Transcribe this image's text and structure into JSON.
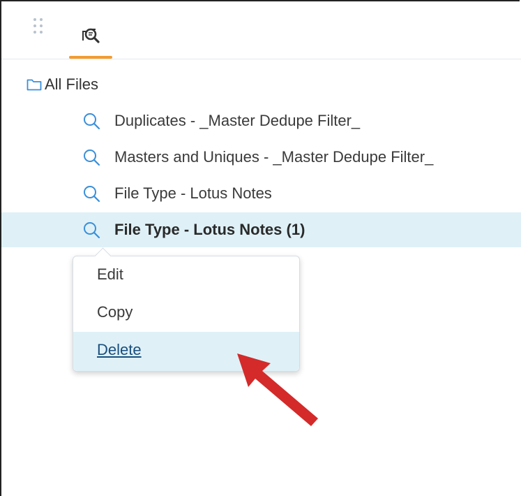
{
  "toolbar": {
    "icons": [
      "drag-handle-icon",
      "saved-search-icon"
    ],
    "active_tab_color": "#f39c2f"
  },
  "tree": {
    "root_label": "All Files",
    "root_icon": "folder-icon",
    "items": [
      {
        "label": "Duplicates - _Master Dedupe Filter_",
        "icon": "search-icon"
      },
      {
        "label": "Masters and Uniques - _Master Dedupe Filter_",
        "icon": "search-icon"
      },
      {
        "label": "File Type - Lotus Notes",
        "icon": "search-icon"
      },
      {
        "label": "File Type - Lotus Notes (1)",
        "icon": "search-icon",
        "selected": true
      }
    ]
  },
  "context_menu": {
    "items": [
      {
        "label": "Edit"
      },
      {
        "label": "Copy"
      },
      {
        "label": "Delete",
        "hovered": true
      }
    ]
  },
  "annotation": {
    "arrow_color": "#d42a2a"
  },
  "colors": {
    "selection": "#dff1f7",
    "icon_blue": "#3a8fd9",
    "link_blue": "#1a4f7d"
  }
}
